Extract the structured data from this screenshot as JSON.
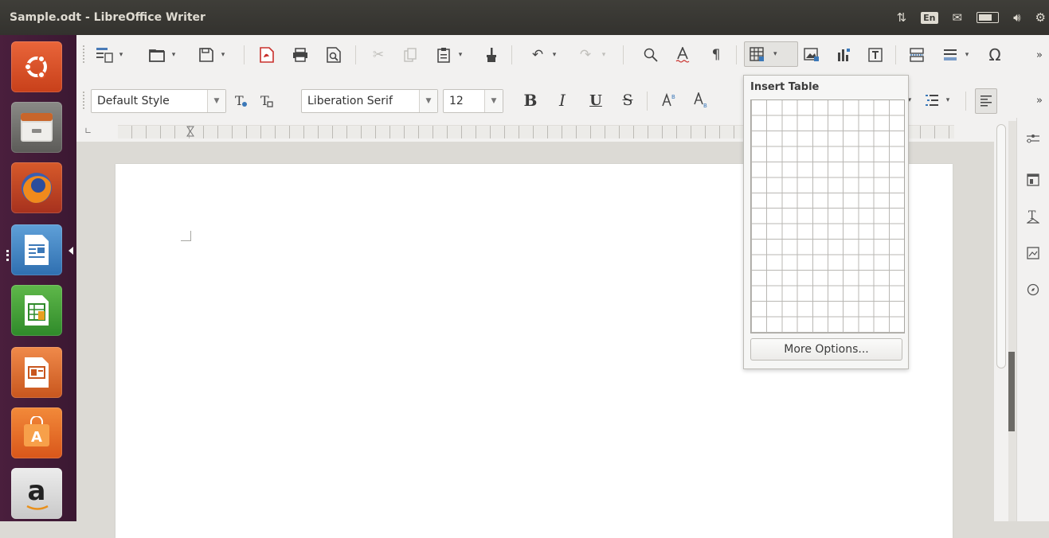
{
  "window": {
    "title": "Sample.odt - LibreOffice Writer"
  },
  "indicators": {
    "keyboard": "En"
  },
  "launcher": {
    "items": [
      {
        "name": "ubuntu-dash"
      },
      {
        "name": "files"
      },
      {
        "name": "firefox"
      },
      {
        "name": "libreoffice-writer"
      },
      {
        "name": "libreoffice-calc"
      },
      {
        "name": "libreoffice-impress"
      },
      {
        "name": "ubuntu-software"
      },
      {
        "name": "amazon"
      }
    ],
    "amazon_glyph": "a"
  },
  "format_bar": {
    "paragraph_style": "Default Style",
    "font_name": "Liberation Serif",
    "font_size": "12"
  },
  "insert_table_popup": {
    "title": "Insert Table",
    "more_options_label": "More Options..."
  },
  "colors": {
    "accent": "#dd4814",
    "title_bar": "#3c3b37",
    "launcher": "#4a1f3d"
  }
}
